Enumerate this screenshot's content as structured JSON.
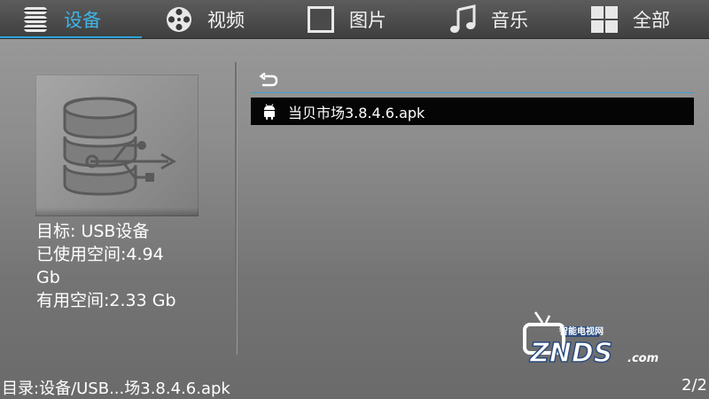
{
  "tabs": [
    {
      "label": "设备",
      "icon": "database-icon",
      "active": true
    },
    {
      "label": "视频",
      "icon": "film-reel-icon",
      "active": false
    },
    {
      "label": "图片",
      "icon": "picture-frame-icon",
      "active": false
    },
    {
      "label": "音乐",
      "icon": "music-note-icon",
      "active": false
    },
    {
      "label": "全部",
      "icon": "grid-icon",
      "active": false
    }
  ],
  "accent_color": "#2aa5dc",
  "device": {
    "icon": "usb-storage-icon",
    "target_line": "目标: USB设备",
    "used_line_1": "已使用空间:4.94",
    "used_line_2": "Gb",
    "free_line": "有用空间:2.33 Gb"
  },
  "list": {
    "back_icon": "return-arrow-icon",
    "items": [
      {
        "name": "当贝市场3.8.4.6.apk",
        "icon": "android-icon",
        "selected": true
      }
    ]
  },
  "watermark": {
    "text_cn": "智能电视网",
    "text_main": "ZNDS",
    "text_suffix": ".com"
  },
  "status": {
    "path": "目录:设备/USB...场3.8.4.6.apk",
    "page": "2/2"
  }
}
